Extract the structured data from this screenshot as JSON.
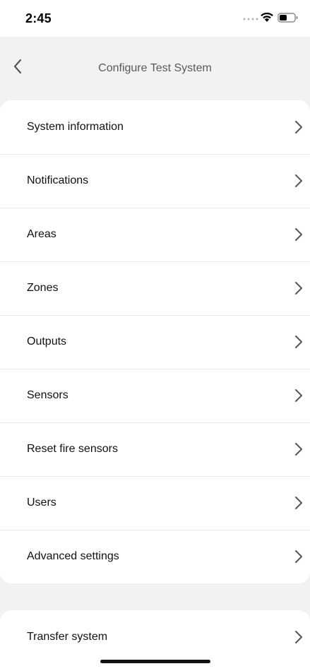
{
  "status_bar": {
    "time": "2:45"
  },
  "nav": {
    "title": "Configure Test System",
    "back_icon": "chevron-left-icon"
  },
  "menu": {
    "items": [
      {
        "label": "System information"
      },
      {
        "label": "Notifications"
      },
      {
        "label": "Areas"
      },
      {
        "label": "Zones"
      },
      {
        "label": "Outputs"
      },
      {
        "label": "Sensors"
      },
      {
        "label": "Reset fire sensors"
      },
      {
        "label": "Users"
      },
      {
        "label": "Advanced settings"
      }
    ],
    "secondary_items": [
      {
        "label": "Transfer system"
      }
    ],
    "row_icon": "chevron-right-icon"
  },
  "colors": {
    "background": "#f2f2f2",
    "card": "#ffffff",
    "divider": "#e6e6e6",
    "title_text": "#5a5a5a"
  }
}
